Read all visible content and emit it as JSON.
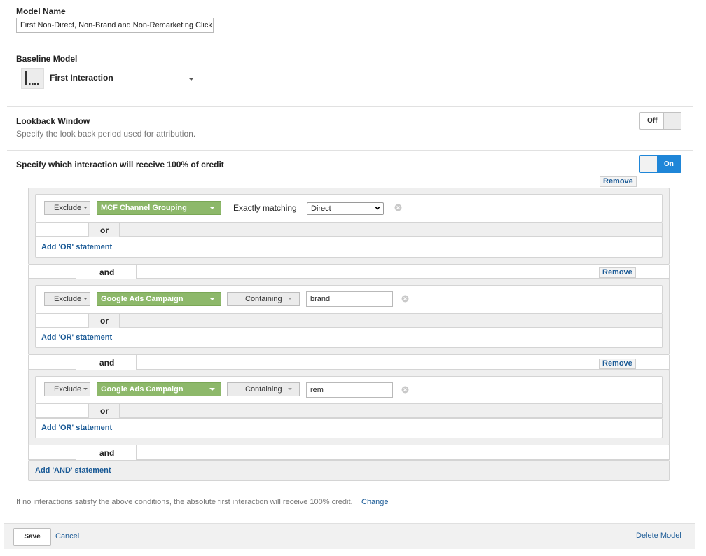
{
  "model_name": {
    "label": "Model Name",
    "value": "First Non-Direct, Non-Brand and Non-Remarketing Click"
  },
  "baseline": {
    "label": "Baseline Model",
    "selected": "First Interaction",
    "icon": "first-interaction-icon"
  },
  "lookback": {
    "title": "Lookback Window",
    "description": "Specify the look back period used for attribution.",
    "toggle_label": "Off"
  },
  "credit": {
    "title": "Specify which interaction will receive 100% of credit",
    "toggle_label": "On"
  },
  "conditions": [
    {
      "remove_label": "Remove",
      "action": "Exclude",
      "dimension": "MCF Channel Grouping",
      "match_type": "Exactly matching",
      "value": "Direct",
      "or_label": "or",
      "add_or_label": "Add 'OR' statement"
    },
    {
      "remove_label": "Remove",
      "action": "Exclude",
      "dimension": "Google Ads Campaign",
      "match_type": "Containing",
      "value": "brand",
      "or_label": "or",
      "add_or_label": "Add 'OR' statement"
    },
    {
      "remove_label": "Remove",
      "action": "Exclude",
      "dimension": "Google Ads Campaign",
      "match_type": "Containing",
      "value": "rem",
      "or_label": "or",
      "add_or_label": "Add 'OR' statement"
    }
  ],
  "and_label": "and",
  "add_and_label": "Add 'AND' statement",
  "fallback": {
    "text": "If no interactions satisfy the above conditions, the absolute first interaction will receive 100% credit.",
    "change_label": "Change"
  },
  "footer": {
    "save": "Save",
    "cancel": "Cancel",
    "delete": "Delete Model"
  },
  "colors": {
    "link": "#1a5a96",
    "toggle_on": "#1f86d8",
    "dimension_green": "#8db86a"
  }
}
